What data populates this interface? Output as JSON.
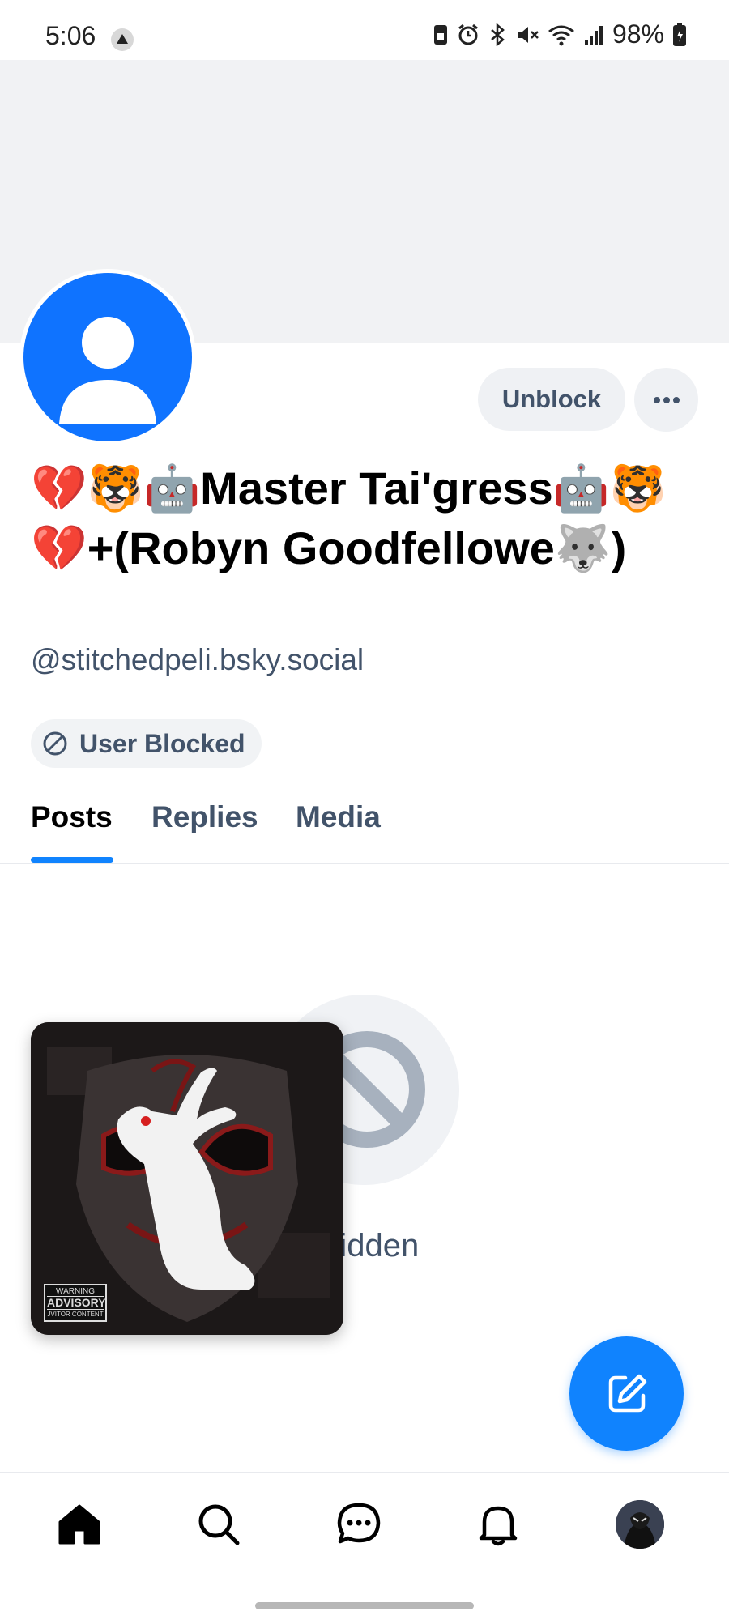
{
  "status_bar": {
    "time": "5:06",
    "battery_percent": "98%",
    "icons": [
      "app-notification-icon",
      "sim-icon",
      "alarm-icon",
      "bluetooth-icon",
      "mute-icon",
      "wifi-icon",
      "signal-icon",
      "battery-icon"
    ]
  },
  "profile": {
    "display_name": "💔🐯🤖Master Tai'gress🤖🐯💔+(Robyn Goodfellowe🐺)",
    "handle": "@stitchedpeli.bsky.social",
    "blocked_label": "User Blocked",
    "avatar_icon": "default-user-avatar-icon",
    "colors": {
      "avatar_bg": "#0f73ff",
      "banner_bg": "#f1f2f4"
    }
  },
  "actions": {
    "unblock_label": "Unblock",
    "more_icon": "ellipsis-icon"
  },
  "tabs": [
    {
      "label": "Posts",
      "active": true
    },
    {
      "label": "Replies",
      "active": false
    },
    {
      "label": "Media",
      "active": false
    }
  ],
  "empty_state": {
    "icon": "block-icon",
    "text_visible": "s hidden"
  },
  "floating_image": {
    "advisory_line1": "WARNING",
    "advisory_line2": "ADVISORY",
    "advisory_line3": "JVITOR CONTENT"
  },
  "fab": {
    "icon": "compose-icon",
    "color": "#1083fe"
  },
  "bottom_nav": [
    "home-icon",
    "search-icon",
    "chat-icon",
    "bell-icon",
    "profile-avatar"
  ],
  "accent_color": "#1083fe"
}
